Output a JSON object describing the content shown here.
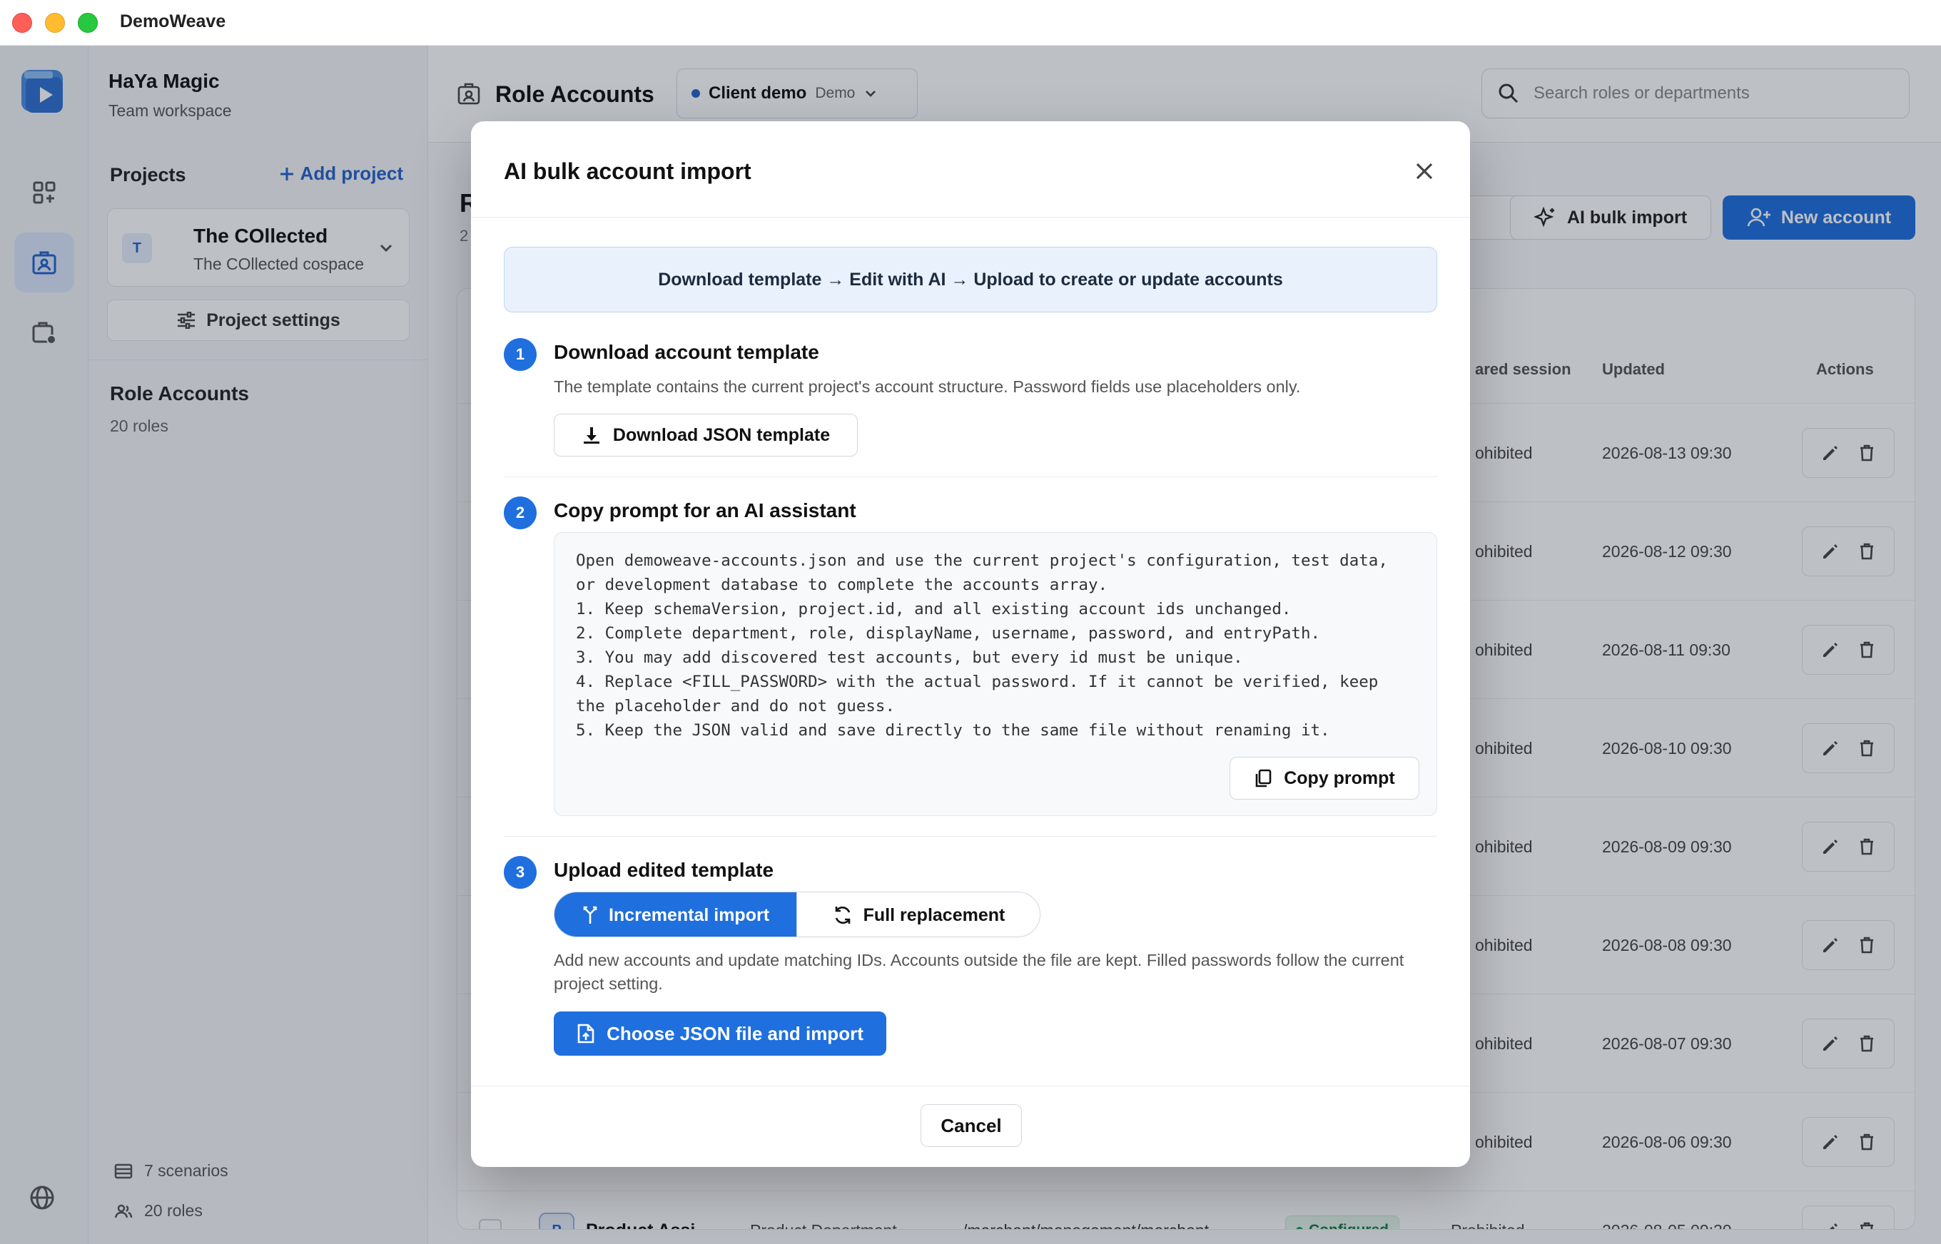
{
  "window": {
    "title": "DemoWeave"
  },
  "workspace": {
    "name": "HaYa Magic",
    "subtitle": "Team workspace"
  },
  "projects": {
    "heading": "Projects",
    "add_label": "Add project",
    "current": {
      "avatar": "T",
      "name": "The COllected",
      "space": "The COllected cospace"
    },
    "settings_label": "Project settings"
  },
  "role_nav": {
    "title": "Role Accounts",
    "count": "20 roles"
  },
  "sidebar_footer": {
    "scenarios": "7 scenarios",
    "roles": "20 roles"
  },
  "header": {
    "title": "Role Accounts",
    "env_name": "Client demo",
    "env_tag": "Demo",
    "search_placeholder": "Search roles or departments"
  },
  "page": {
    "title_fragment": "R",
    "subtitle_fragment": "2"
  },
  "actions": {
    "partial_label": ")",
    "ai_import": "AI bulk import",
    "new_account": "New account"
  },
  "table": {
    "headers": {
      "shared_session": "ared session",
      "updated": "Updated",
      "actions": "Actions"
    },
    "rows": [
      {
        "session": "ohibited",
        "updated": "2026-08-13 09:30"
      },
      {
        "session": "ohibited",
        "updated": "2026-08-12 09:30"
      },
      {
        "session": "ohibited",
        "updated": "2026-08-11 09:30"
      },
      {
        "session": "ohibited",
        "updated": "2026-08-10 09:30"
      },
      {
        "session": "ohibited",
        "updated": "2026-08-09 09:30"
      },
      {
        "session": "ohibited",
        "updated": "2026-08-08 09:30"
      },
      {
        "session": "ohibited",
        "updated": "2026-08-07 09:30"
      },
      {
        "session": "ohibited",
        "updated": "2026-08-06 09:30"
      }
    ],
    "last_row": {
      "avatar": "P",
      "name": "Product Assi...",
      "department": "Product Department",
      "path": "/merchant/management/merchant",
      "status": "Configured",
      "session": "Prohibited",
      "updated": "2026-08-05 09:30"
    }
  },
  "modal": {
    "title": "AI bulk account import",
    "banner": "Download template → Edit with AI → Upload to create or update accounts",
    "step1": {
      "num": "1",
      "title": "Download account template",
      "desc": "The template contains the current project's account structure. Password fields use placeholders only.",
      "button": "Download JSON template"
    },
    "step2": {
      "num": "2",
      "title": "Copy prompt for an AI assistant",
      "prompt": "Open demoweave-accounts.json and use the current project's configuration, test data,\nor development database to complete the accounts array.\n1. Keep schemaVersion, project.id, and all existing account ids unchanged.\n2. Complete department, role, displayName, username, password, and entryPath.\n3. You may add discovered test accounts, but every id must be unique.\n4. Replace <FILL_PASSWORD> with the actual password. If it cannot be verified, keep\nthe placeholder and do not guess.\n5. Keep the JSON valid and save directly to the same file without renaming it.",
      "copy_button": "Copy prompt"
    },
    "step3": {
      "num": "3",
      "title": "Upload edited template",
      "mode_incremental": "Incremental import",
      "mode_full": "Full replacement",
      "desc": "Add new accounts and update matching IDs. Accounts outside the file are kept. Filled passwords follow the current project setting.",
      "upload_button": "Choose JSON file and import"
    },
    "cancel": "Cancel"
  },
  "colors": {
    "accent": "#1f6fde",
    "success": "#1b9b4f",
    "banner_bg": "#e9f1fd"
  }
}
